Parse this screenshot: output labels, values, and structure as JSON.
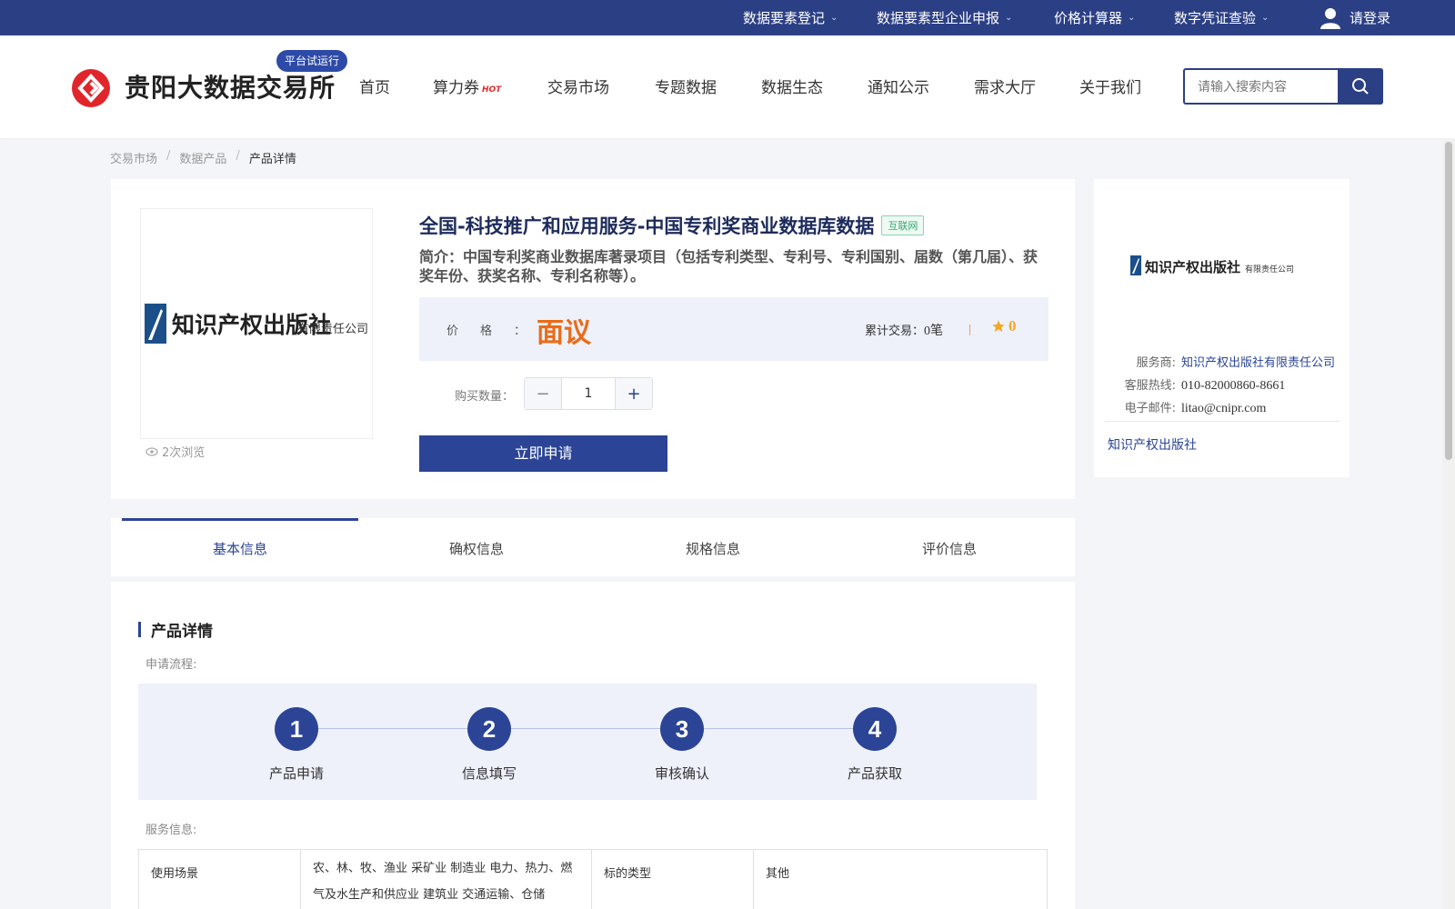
{
  "topbar": {
    "links": [
      {
        "label": "数据要素登记"
      },
      {
        "label": "数据要素型企业申报"
      },
      {
        "label": "价格计算器"
      },
      {
        "label": "数字凭证查验"
      }
    ],
    "login_label": "请登录"
  },
  "header": {
    "brand": "贵阳大数据交易所",
    "badge": "平台试运行",
    "nav": [
      "首页",
      "算力券",
      "交易市场",
      "专题数据",
      "数据生态",
      "通知公示",
      "需求大厅",
      "关于我们"
    ],
    "hot_tag": "HOT",
    "search_placeholder": "请输入搜索内容"
  },
  "breadcrumb": [
    "交易市场",
    "数据产品",
    "产品详情"
  ],
  "product": {
    "title": "全国-科技推广和应用服务-中国专利奖商业数据库数据",
    "tag": "互联网",
    "description": "简介：中国专利奖商业数据库著录项目（包括专利类型、专利号、专利国别、届数（第几届）、获奖年份、获奖名称、专利名称等）。",
    "price_label": "价格",
    "price_value": "面议",
    "trades_label": "累计交易：",
    "trades_value": "0笔",
    "rating": "0",
    "views": "2次浏览",
    "qty_label": "购买数量：",
    "qty_value": "1",
    "apply_label": "立即申请",
    "image_logo_text": "知识产权出版社",
    "image_logo_suffix": "有限责任公司"
  },
  "seller": {
    "logo_text": "知识产权出版社",
    "logo_suffix": "有限责任公司",
    "provider_label": "服务商:",
    "provider_value": "知识产权出版社有限责任公司",
    "hotline_label": "客服热线:",
    "hotline_value": "010-82000860-8661",
    "email_label": "电子邮件:",
    "email_value": "litao@cnipr.com",
    "name": "知识产权出版社"
  },
  "tabs": [
    "基本信息",
    "确权信息",
    "规格信息",
    "评价信息"
  ],
  "details": {
    "section_title": "产品详情",
    "flow_label": "申请流程:",
    "steps": [
      {
        "num": "1",
        "label": "产品申请"
      },
      {
        "num": "2",
        "label": "信息填写"
      },
      {
        "num": "3",
        "label": "审核确认"
      },
      {
        "num": "4",
        "label": "产品获取"
      }
    ],
    "service_label": "服务信息:",
    "table": {
      "k1": "使用场景",
      "v1": "农、林、牧、渔业 采矿业 制造业 电力、热力、燃气及水生产和供应业 建筑业 交通运输、仓储",
      "k2": "标的类型",
      "v2": "其他"
    }
  },
  "colors": {
    "primary": "#2b3f85",
    "accent": "#2b4496",
    "price": "#ea6c19",
    "rating": "#f5a623"
  }
}
